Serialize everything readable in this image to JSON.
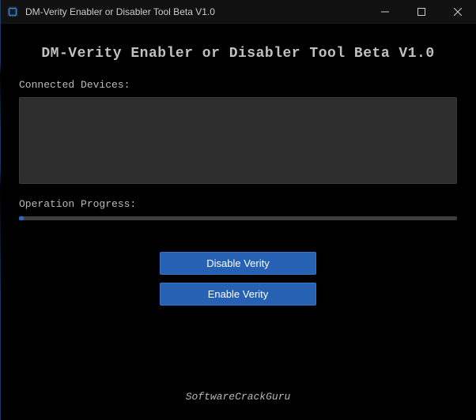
{
  "titlebar": {
    "title": "DM-Verity Enabler or Disabler Tool Beta V1.0"
  },
  "main": {
    "heading": "DM-Verity Enabler or Disabler Tool Beta V1.0",
    "devices_label": "Connected Devices:",
    "progress_label": "Operation Progress:",
    "progress_value": 1
  },
  "buttons": {
    "disable_label": "Disable Verity",
    "enable_label": "Enable Verity"
  },
  "footer": {
    "credit": "SoftwareCrackGuru"
  }
}
